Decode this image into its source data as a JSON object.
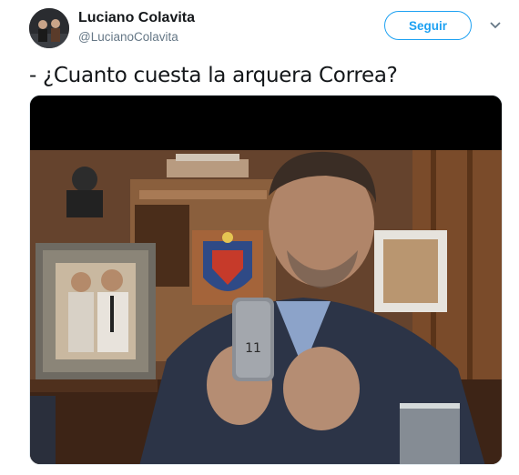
{
  "author": {
    "name": "Luciano Colavita",
    "handle": "@LucianoColavita"
  },
  "follow_label": "Seguir",
  "tweet": {
    "text": "- ¿Cuanto cuesta la arquera Correa?"
  },
  "media": {
    "type": "photo",
    "phone_sticker": "11"
  },
  "colors": {
    "accent": "#1da1f2",
    "handle": "#657786",
    "text": "#14171a"
  },
  "icons": {
    "more": "chevron-down-icon"
  }
}
